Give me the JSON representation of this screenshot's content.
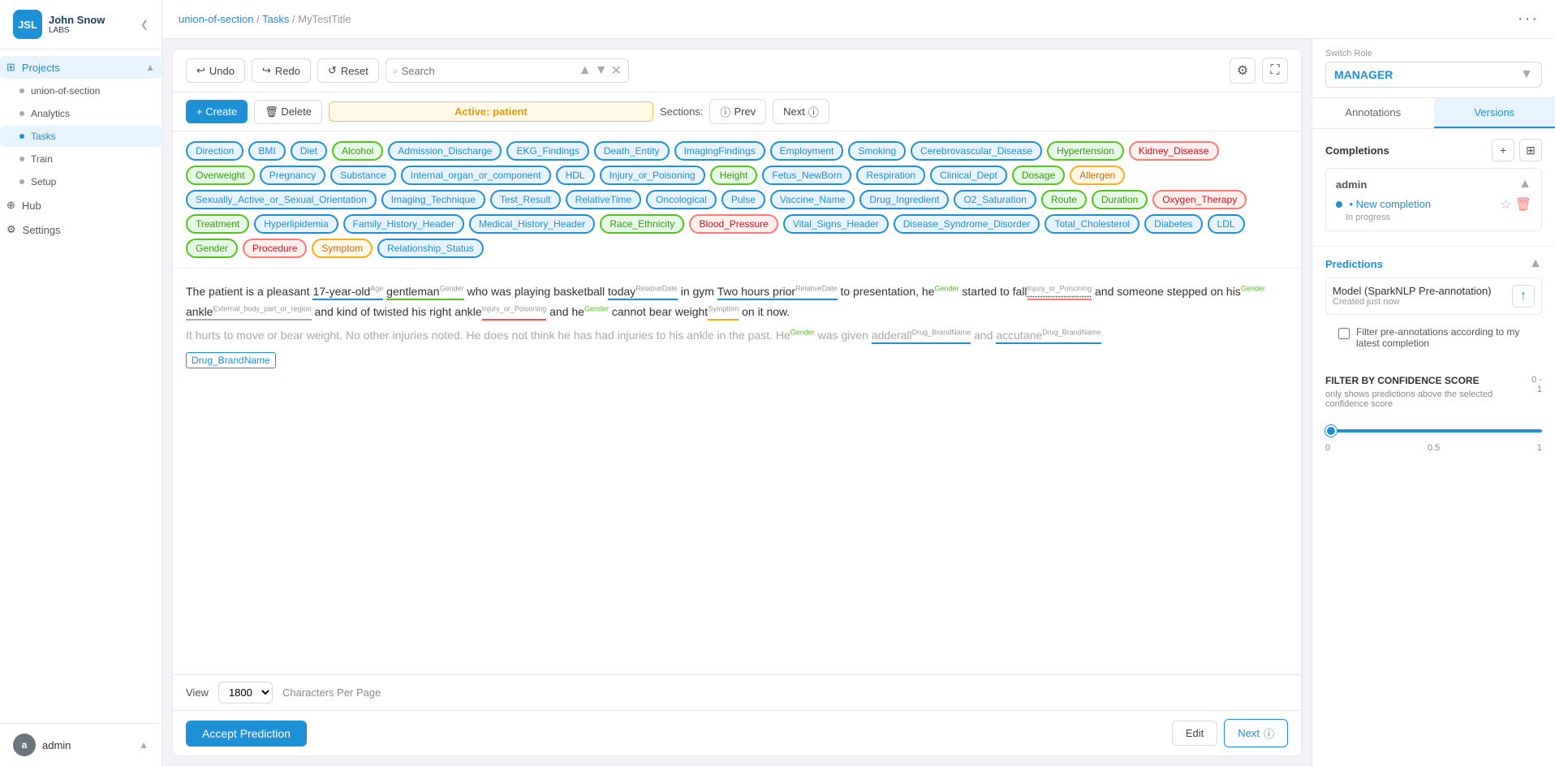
{
  "sidebar": {
    "logo": {
      "line1": "John Snow",
      "line2": "LABS"
    },
    "collapse_icon": "❮",
    "nav_items": [
      {
        "id": "projects",
        "label": "Projects",
        "icon": "⊞",
        "active": true,
        "expanded": true
      },
      {
        "id": "union-of-section",
        "label": "union-of-section",
        "indent": true
      },
      {
        "id": "analytics",
        "label": "Analytics",
        "indent": true
      },
      {
        "id": "tasks",
        "label": "Tasks",
        "indent": true,
        "active": true
      },
      {
        "id": "train",
        "label": "Train",
        "indent": true
      },
      {
        "id": "setup",
        "label": "Setup",
        "indent": true
      },
      {
        "id": "hub",
        "label": "Hub",
        "icon": "⊕"
      },
      {
        "id": "settings",
        "label": "Settings",
        "icon": "⚙"
      }
    ],
    "user": {
      "avatar": "a",
      "name": "admin",
      "expand_icon": "▲"
    }
  },
  "topbar": {
    "breadcrumb": [
      "union-of-section",
      "Tasks",
      "MyTestTitle"
    ],
    "breadcrumb_separator": "/",
    "dots_menu": "···"
  },
  "toolbar": {
    "undo_label": "Undo",
    "redo_label": "Redo",
    "reset_label": "Reset",
    "search_placeholder": "Search",
    "settings_icon": "⚙",
    "fullscreen_icon": "⛶"
  },
  "mid_toolbar": {
    "create_label": "+ Create",
    "delete_label": "🗑 Delete",
    "active_text": "Active: patient",
    "sections_label": "Sections:",
    "prev_label": "Prev",
    "next_label": "Next"
  },
  "labels": [
    {
      "text": "Direction",
      "color": "#e8f4fd",
      "border": "#1e90d6",
      "text_color": "#1e90d6"
    },
    {
      "text": "BMI",
      "color": "#e8f4fd",
      "border": "#1e90d6",
      "text_color": "#1e90d6"
    },
    {
      "text": "Diet",
      "color": "#e8f4fd",
      "border": "#1e90d6",
      "text_color": "#1e90d6"
    },
    {
      "text": "Alcohol",
      "color": "#e6f9e6",
      "border": "#52c41a",
      "text_color": "#389e0d"
    },
    {
      "text": "Admission_Discharge",
      "color": "#e8f4fd",
      "border": "#1e90d6",
      "text_color": "#1e90d6"
    },
    {
      "text": "EKG_Findings",
      "color": "#e8f4fd",
      "border": "#1e90d6",
      "text_color": "#1e90d6"
    },
    {
      "text": "Death_Entity",
      "color": "#e8f4fd",
      "border": "#1e90d6",
      "text_color": "#1e90d6"
    },
    {
      "text": "ImagingFindings",
      "color": "#e8f4fd",
      "border": "#1e90d6",
      "text_color": "#1e90d6"
    },
    {
      "text": "Employment",
      "color": "#e8f4fd",
      "border": "#1e90d6",
      "text_color": "#1e90d6"
    },
    {
      "text": "Smoking",
      "color": "#e8f4fd",
      "border": "#1e90d6",
      "text_color": "#1e90d6"
    },
    {
      "text": "Cerebrovascular_Disease",
      "color": "#e8f4fd",
      "border": "#1e90d6",
      "text_color": "#1e90d6"
    },
    {
      "text": "Hypertension",
      "color": "#e6f9e6",
      "border": "#52c41a",
      "text_color": "#389e0d"
    },
    {
      "text": "Kidney_Disease",
      "color": "#fff0f0",
      "border": "#ff7875",
      "text_color": "#cf1322"
    },
    {
      "text": "Overweight",
      "color": "#e6f9e6",
      "border": "#52c41a",
      "text_color": "#389e0d"
    },
    {
      "text": "Pregnancy",
      "color": "#e8f4fd",
      "border": "#1e90d6",
      "text_color": "#1e90d6"
    },
    {
      "text": "Substance",
      "color": "#e8f4fd",
      "border": "#1e90d6",
      "text_color": "#1e90d6"
    },
    {
      "text": "Internal_organ_or_component",
      "color": "#e8f4fd",
      "border": "#1e90d6",
      "text_color": "#1e90d6"
    },
    {
      "text": "HDL",
      "color": "#e8f4fd",
      "border": "#1e90d6",
      "text_color": "#1e90d6"
    },
    {
      "text": "Injury_or_Poisoning",
      "color": "#e8f4fd",
      "border": "#1e90d6",
      "text_color": "#1e90d6"
    },
    {
      "text": "Height",
      "color": "#e6f9e6",
      "border": "#52c41a",
      "text_color": "#389e0d"
    },
    {
      "text": "Fetus_NewBorn",
      "color": "#e8f4fd",
      "border": "#1e90d6",
      "text_color": "#1e90d6"
    },
    {
      "text": "Respiration",
      "color": "#e8f4fd",
      "border": "#1e90d6",
      "text_color": "#1e90d6"
    },
    {
      "text": "Clinical_Dept",
      "color": "#e8f4fd",
      "border": "#1e90d6",
      "text_color": "#1e90d6"
    },
    {
      "text": "Dosage",
      "color": "#e6f9e6",
      "border": "#52c41a",
      "text_color": "#389e0d"
    },
    {
      "text": "Allergen",
      "color": "#fff9e6",
      "border": "#faad14",
      "text_color": "#d46b08"
    },
    {
      "text": "Sexually_Active_or_Sexual_Orientation",
      "color": "#e8f4fd",
      "border": "#1e90d6",
      "text_color": "#1e90d6"
    },
    {
      "text": "Imaging_Technique",
      "color": "#e8f4fd",
      "border": "#1e90d6",
      "text_color": "#1e90d6"
    },
    {
      "text": "Test_Result",
      "color": "#e8f4fd",
      "border": "#1e90d6",
      "text_color": "#1e90d6"
    },
    {
      "text": "RelativeTime",
      "color": "#e8f4fd",
      "border": "#1e90d6",
      "text_color": "#1e90d6"
    },
    {
      "text": "Oncological",
      "color": "#e8f4fd",
      "border": "#1e90d6",
      "text_color": "#1e90d6"
    },
    {
      "text": "Pulse",
      "color": "#e8f4fd",
      "border": "#1e90d6",
      "text_color": "#1e90d6"
    },
    {
      "text": "Vaccine_Name",
      "color": "#e8f4fd",
      "border": "#1e90d6",
      "text_color": "#1e90d6"
    },
    {
      "text": "Drug_Ingredient",
      "color": "#e8f4fd",
      "border": "#1e90d6",
      "text_color": "#1e90d6"
    },
    {
      "text": "O2_Saturation",
      "color": "#e8f4fd",
      "border": "#1e90d6",
      "text_color": "#1e90d6"
    },
    {
      "text": "Route",
      "color": "#e6f9e6",
      "border": "#52c41a",
      "text_color": "#389e0d"
    },
    {
      "text": "Duration",
      "color": "#e6f9e6",
      "border": "#52c41a",
      "text_color": "#389e0d"
    },
    {
      "text": "Oxygen_Therapy",
      "color": "#fff0f0",
      "border": "#ff7875",
      "text_color": "#cf1322"
    },
    {
      "text": "Treatment",
      "color": "#e6f9e6",
      "border": "#52c41a",
      "text_color": "#389e0d"
    },
    {
      "text": "Hyperlipidemia",
      "color": "#e8f4fd",
      "border": "#1e90d6",
      "text_color": "#1e90d6"
    },
    {
      "text": "Family_History_Header",
      "color": "#e8f4fd",
      "border": "#1e90d6",
      "text_color": "#1e90d6"
    },
    {
      "text": "Medical_History_Header",
      "color": "#e8f4fd",
      "border": "#1e90d6",
      "text_color": "#1e90d6"
    },
    {
      "text": "Race_Ethnicity",
      "color": "#e6f9e6",
      "border": "#52c41a",
      "text_color": "#389e0d"
    },
    {
      "text": "Blood_Pressure",
      "color": "#fff0f0",
      "border": "#ff7875",
      "text_color": "#cf1322"
    },
    {
      "text": "Vital_Signs_Header",
      "color": "#e8f4fd",
      "border": "#1e90d6",
      "text_color": "#1e90d6"
    },
    {
      "text": "Disease_Syndrome_Disorder",
      "color": "#e8f4fd",
      "border": "#1e90d6",
      "text_color": "#1e90d6"
    },
    {
      "text": "Total_Cholesterol",
      "color": "#e8f4fd",
      "border": "#1e90d6",
      "text_color": "#1e90d6"
    },
    {
      "text": "Diabetes",
      "color": "#e8f4fd",
      "border": "#1e90d6",
      "text_color": "#1e90d6"
    },
    {
      "text": "LDL",
      "color": "#e8f4fd",
      "border": "#1e90d6",
      "text_color": "#1e90d6"
    },
    {
      "text": "Gender",
      "color": "#e6f9e6",
      "border": "#52c41a",
      "text_color": "#389e0d"
    },
    {
      "text": "Procedure",
      "color": "#fff0f0",
      "border": "#ff7875",
      "text_color": "#cf1322"
    },
    {
      "text": "Symptom",
      "color": "#fff9e6",
      "border": "#faad14",
      "text_color": "#d46b08"
    },
    {
      "text": "Relationship_Status",
      "color": "#e8f4fd",
      "border": "#1e90d6",
      "text_color": "#1e90d6"
    }
  ],
  "view": {
    "label": "View",
    "value": "1800",
    "unit": "Characters Per Page"
  },
  "action_bar": {
    "accept_label": "Accept Prediction",
    "edit_label": "Edit",
    "next_label": "Next"
  },
  "right_panel": {
    "switch_role_label": "Switch Role",
    "role": "MANAGER",
    "tabs": [
      {
        "id": "annotations",
        "label": "Annotations",
        "active": false
      },
      {
        "id": "versions",
        "label": "Versions",
        "active": true
      }
    ],
    "completions_title": "Completions",
    "add_icon": "+",
    "grid_icon": "⊞",
    "admin_label": "admin",
    "completion": {
      "dot_label": "• New completion",
      "status": "In progress"
    },
    "predictions_title": "Predictions",
    "prediction": {
      "name": "Model (SparkNLP Pre-annotation)",
      "created": "Created just now"
    },
    "filter_label": "Filter pre-annotations according to my latest completion",
    "confidence": {
      "title": "FILTER BY CONFIDENCE SCORE",
      "description": "only shows predictions above the selected confidence score",
      "range": "0 - 1",
      "min": 0,
      "max": 1,
      "value": 0,
      "step": 0.01,
      "label_min": "0",
      "label_mid": "0.5",
      "label_max": "1"
    }
  }
}
